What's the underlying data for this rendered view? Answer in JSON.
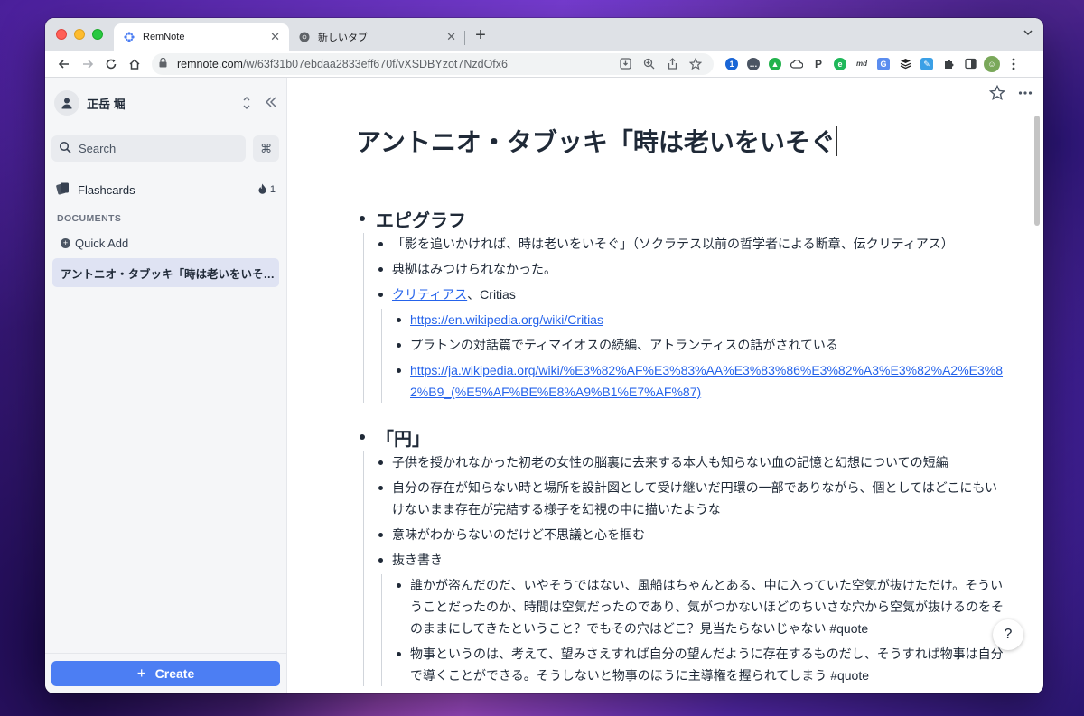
{
  "browser": {
    "tabs": [
      {
        "title": "RemNote",
        "active": true
      },
      {
        "title": "新しいタブ",
        "active": false
      }
    ],
    "url_domain": "remnote.com",
    "url_path": "/w/63f31b07ebdaa2833eff670f/vXSDBYzot7NzdOfx6",
    "extension_icons": [
      "1password-icon",
      "chat-icon",
      "green-extension-icon",
      "cloud-icon",
      "paypal-icon",
      "evernote-icon",
      "markdown-icon",
      "translate-icon",
      "buffer-icon",
      "edit-extension-icon",
      "puzzle-icon",
      "sidepanel-icon",
      "profile-avatar-icon",
      "kebab-menu-icon"
    ],
    "ext_labels": {
      "md": "md"
    }
  },
  "sidebar": {
    "user_name": "正岳 堀",
    "search_label": "Search",
    "cmd_label": "⌘",
    "flashcards_label": "Flashcards",
    "flashcards_count": "1",
    "documents_heading": "DOCUMENTS",
    "quick_add_label": "Quick Add",
    "active_document": "アントニオ・タブッキ「時は老いをいそ…",
    "create_label": "Create"
  },
  "document": {
    "title": "アントニオ・タブッキ「時は老いをいそぐ",
    "sections": [
      {
        "heading": "エピグラフ",
        "items": [
          {
            "text": "「影を追いかければ、時は老いをいそぐ」（ソクラテス以前の哲学者による断章、伝クリティアス）"
          },
          {
            "text": "典拠はみつけられなかった。"
          },
          {
            "link": "クリティアス",
            "text": "、Critias"
          },
          {
            "link": "https://en.wikipedia.org/wiki/Critias"
          },
          {
            "text": "プラトンの対話篇でティマイオスの続編、アトランティスの話がされている"
          },
          {
            "link": "https://ja.wikipedia.org/wiki/%E3%82%AF%E3%83%AA%E3%83%86%E3%82%A3%E3%82%A2%E3%82%B9_(%E5%AF%BE%E8%A9%B1%E7%AF%87)"
          }
        ]
      },
      {
        "heading": "「円」",
        "items": [
          {
            "text": "子供を授かれなかった初老の女性の脳裏に去来する本人も知らない血の記憶と幻想についての短編"
          },
          {
            "text": "自分の存在が知らない時と場所を設計図として受け継いだ円環の一部でありながら、個としてはどこにもいけないまま存在が完結する様子を幻視の中に描いたような"
          },
          {
            "text": "意味がわからないのだけど不思議と心を掴む"
          },
          {
            "text": "抜き書き"
          },
          {
            "text": "誰かが盗んだのだ、いやそうではない、風船はちゃんとある、中に入っていた空気が抜けただけ。そういうことだったのか、時間は空気だったのであり、気がつかないほどのちいさな穴から空気が抜けるのをそのままにしてきたということ？でもその穴はどこ？見当たらないじゃない #quote"
          },
          {
            "text": "物事というのは、考えて、望みさえすれば自分の望んだように存在するものだし、そうすれば物事は自分で導くことができる。そうしないと物事のほうに主導権を握られてしまう #quote"
          }
        ]
      }
    ]
  },
  "help_label": "?"
}
